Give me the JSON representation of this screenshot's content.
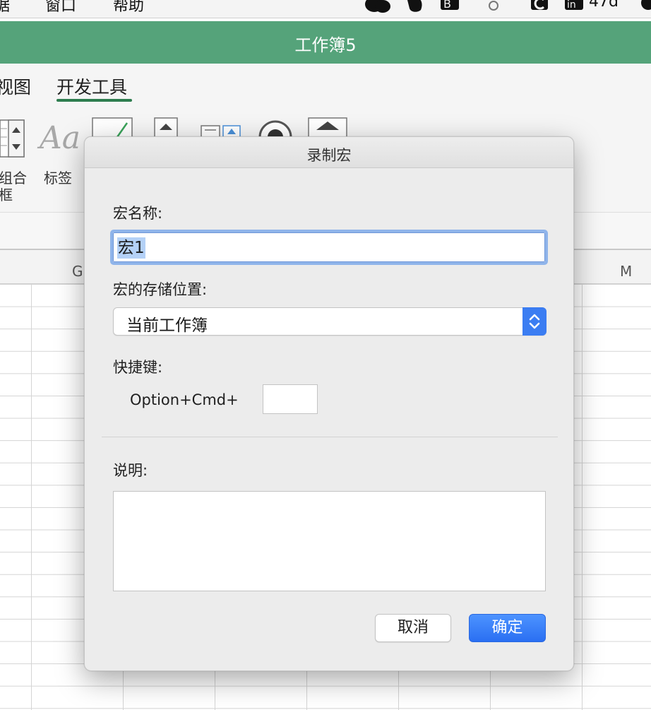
{
  "menubar": {
    "items": [
      "据",
      "窗口",
      "帮助"
    ],
    "tray_text": "47d"
  },
  "window": {
    "title": "工作簿5"
  },
  "ribbon": {
    "tabs": [
      "视图",
      "开发工具"
    ],
    "active_tab": "开发工具",
    "labels": {
      "combo_line1": "组合",
      "combo_line2": "框",
      "label": "标签"
    },
    "aa_glyph": "Aa"
  },
  "sheet": {
    "columns": [
      "G",
      "M"
    ]
  },
  "colors": {
    "accent_green": "#55a37a",
    "tab_underline": "#2e7d4f",
    "primary_blue": "#2a6ff2"
  },
  "dialog": {
    "title": "录制宏",
    "macro_name_label": "宏名称:",
    "macro_name_value": "宏1",
    "store_label": "宏的存储位置:",
    "store_value": "当前工作簿",
    "shortcut_label": "快捷键:",
    "shortcut_modifier": "Option+Cmd+",
    "shortcut_key_value": "",
    "description_label": "说明:",
    "description_value": "",
    "cancel_label": "取消",
    "ok_label": "确定"
  }
}
